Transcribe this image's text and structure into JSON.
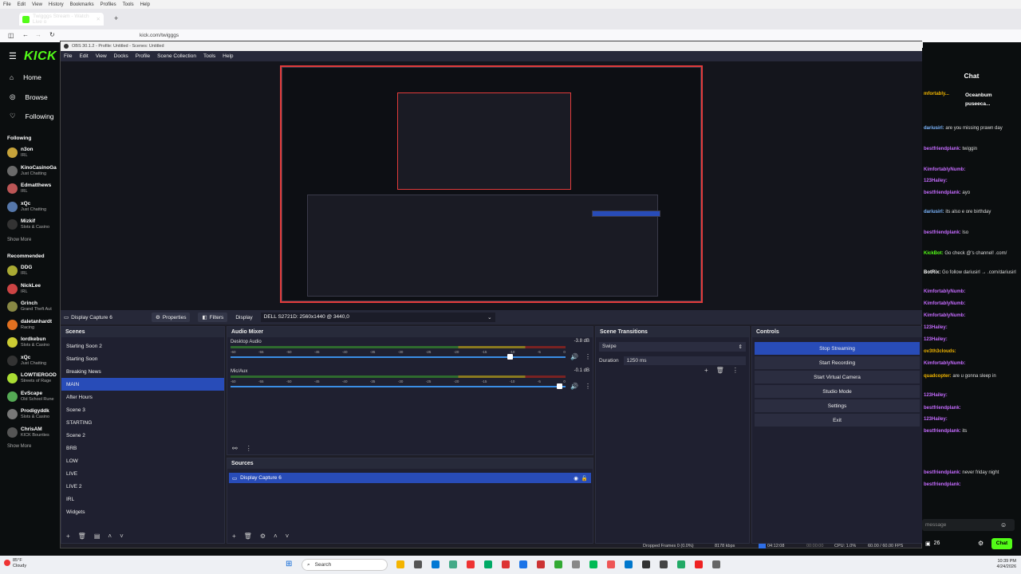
{
  "browser": {
    "menu": [
      "File",
      "Edit",
      "View",
      "History",
      "Bookmarks",
      "Profiles",
      "Tools",
      "Help"
    ],
    "tab_title": "Twigggs Stream - Watch Live o",
    "url": "kick.com/twigggs"
  },
  "kick": {
    "logo": "KICK",
    "nav": [
      {
        "label": "Home",
        "icon": "home-icon"
      },
      {
        "label": "Browse",
        "icon": "compass-icon"
      },
      {
        "label": "Following",
        "icon": "heart-icon"
      }
    ],
    "following_title": "Following",
    "following": [
      {
        "name": "n3on",
        "sub": "IRL"
      },
      {
        "name": "KinoCasinoGa",
        "sub": "Just Chatting"
      },
      {
        "name": "Edmatthews",
        "sub": "IRL"
      },
      {
        "name": "xQc",
        "sub": "Just Chatting"
      },
      {
        "name": "Mizkif",
        "sub": "Slots & Casino"
      }
    ],
    "show_more": "Show More",
    "recommended_title": "Recommended",
    "recommended": [
      {
        "name": "DDG",
        "sub": "IRL"
      },
      {
        "name": "NickLee",
        "sub": "IRL"
      },
      {
        "name": "Grinch",
        "sub": "Grand Theft Aut"
      },
      {
        "name": "daletanhardt",
        "sub": "Racing"
      },
      {
        "name": "lordkebun",
        "sub": "Slots & Casino"
      },
      {
        "name": "xQc",
        "sub": "Just Chatting"
      },
      {
        "name": "LOWTIERGOD",
        "sub": "Streets of Rage"
      },
      {
        "name": "EvScape",
        "sub": "Old School Rune"
      },
      {
        "name": "Prodigyddk",
        "sub": "Slots & Casino"
      },
      {
        "name": "ChrisAM",
        "sub": "KICK Bounties"
      }
    ],
    "show_more2": "Show More",
    "viewer_count": "26"
  },
  "obs": {
    "title": "OBS 30.1.2 - Profile: Untitled - Scenes: Untitled",
    "menu": [
      "File",
      "Edit",
      "View",
      "Docks",
      "Profile",
      "Scene Collection",
      "Tools",
      "Help"
    ],
    "source_bar": {
      "source": "Display Capture 6",
      "properties": "Properties",
      "filters": "Filters",
      "display_label": "Display",
      "display_value": "DELL S2721D: 2560x1440 @ 3440,0"
    },
    "scenes_title": "Scenes",
    "scenes": [
      "Starting Soon 2",
      "Starting Soon",
      "Breaking News",
      "MAIN",
      "After Hours",
      "Scene 3",
      "STARTING",
      "Scene 2",
      "BRB",
      "LOW",
      "LIVE",
      "LIVE 2",
      "IRL",
      "Widgets"
    ],
    "selected_scene": 3,
    "mixer_title": "Audio Mixer",
    "channels": [
      {
        "name": "Desktop Audio",
        "db": "-3.8 dB",
        "level": 0.84
      },
      {
        "name": "Mic/Aux",
        "db": "-0.1 dB",
        "level": 0.99
      }
    ],
    "ticks": [
      "-60",
      "-55",
      "-50",
      "-45",
      "-40",
      "-35",
      "-30",
      "-25",
      "-20",
      "-15",
      "-10",
      "-5",
      "0"
    ],
    "sources_title": "Sources",
    "sources": [
      "Display Capture 6"
    ],
    "transitions_title": "Scene Transitions",
    "transition": "Swipe",
    "duration_label": "Duration",
    "duration": "1250 ms",
    "controls_title": "Controls",
    "controls": [
      "Stop Streaming",
      "Start Recording",
      "Start Virtual Camera",
      "Studio Mode",
      "Settings",
      "Exit"
    ],
    "status": {
      "dropped": "Dropped Frames 0 (0.0%)",
      "bitrate": "8178 kbps",
      "live_time": "04:12:08",
      "rec_time": "00:00:00",
      "cpu": "CPU: 1.0%",
      "fps": "60.00 / 60.00 FPS"
    }
  },
  "chat": {
    "title": "Chat",
    "messages": [
      {
        "user": "mfortably...",
        "text": "",
        "color": "#f0b400"
      },
      {
        "user": "dariusirl:",
        "text": "are you missing prawn day",
        "color": "#7db7ff"
      },
      {
        "user": "bestfriendplank:",
        "text": "twiggin",
        "color": "#c56bff"
      },
      {
        "user": "KimfortablyNumb:",
        "text": "",
        "color": "#c56bff"
      },
      {
        "user": "123Hailey:",
        "text": "",
        "color": "#c56bff"
      },
      {
        "user": "bestfriendplank:",
        "text": "ayo",
        "color": "#c56bff"
      },
      {
        "user": "dariusirl:",
        "text": "its also e ore birthday",
        "color": "#7db7ff"
      },
      {
        "user": "bestfriendplank:",
        "text": "lso",
        "color": "#c56bff"
      },
      {
        "user": "KickBot:",
        "text": "Go check @'s channel! .com/",
        "color": "#53fc18"
      },
      {
        "user": "BotRix:",
        "text": "Go follow dariusirl → .com/dariusirl",
        "color": "#ffffff"
      },
      {
        "user": "KimfortablyNumb:",
        "text": "",
        "color": "#c56bff"
      },
      {
        "user": "KimfortablyNumb:",
        "text": "",
        "color": "#c56bff"
      },
      {
        "user": "KimfortablyNumb:",
        "text": "",
        "color": "#c56bff"
      },
      {
        "user": "123Hailey:",
        "text": "",
        "color": "#c56bff"
      },
      {
        "user": "123Hailey:",
        "text": "",
        "color": "#c56bff"
      },
      {
        "user": "ov3th3clouds:",
        "text": "",
        "color": "#f0b400"
      },
      {
        "user": "KimfortablyNumb:",
        "text": "",
        "color": "#c56bff"
      },
      {
        "user": "quadcopter:",
        "text": "are u gonna sleep in",
        "color": "#f0b400"
      },
      {
        "user": "123Hailey:",
        "text": "",
        "color": "#c56bff"
      },
      {
        "user": "bestfriendplank:",
        "text": "",
        "color": "#c56bff"
      },
      {
        "user": "123Hailey:",
        "text": "",
        "color": "#c56bff"
      },
      {
        "user": "bestfriendplank:",
        "text": "its",
        "color": "#c56bff"
      },
      {
        "user": "bestfriendplank:",
        "text": "never friday night",
        "color": "#c56bff"
      },
      {
        "user": "bestfriendplank:",
        "text": "",
        "color": "#c56bff"
      },
      {
        "user": "nceAdamHeman:",
        "text": "The woods are and dark",
        "color": "#f0b400"
      }
    ],
    "top_users": [
      "Oceanbum",
      "puseeca..."
    ],
    "input_placeholder": "message",
    "viewer_count": "26",
    "send": "Chat"
  },
  "taskbar": {
    "weather_temp": "85°F",
    "weather_desc": "Cloudy",
    "search": "Search",
    "time": "10:39 PM",
    "date": "4/24/2026"
  }
}
